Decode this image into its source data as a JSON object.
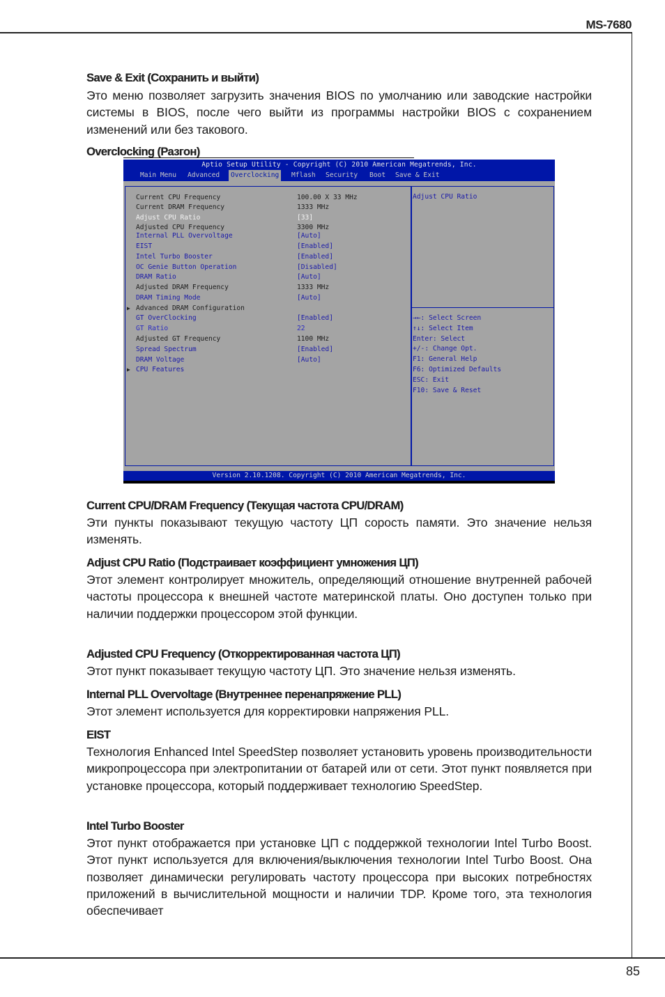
{
  "header": {
    "model": "MS-7680"
  },
  "footer": {
    "page_number": "85"
  },
  "sections_top": [
    {
      "heading": "Save & Exit (Сохранить и выйти)",
      "text": "Это меню позволяет загрузить значения BIOS по умолчанию или заводские настройки системы в BIOS, после чего выйти из программы настройки BIOS с сохранением изменений или без такового."
    },
    {
      "heading": "Overclocking (Разгон)"
    }
  ],
  "bios": {
    "title": "Aptio Setup Utility - Copyright (C) 2010 American Megatrends, Inc.",
    "tabs": [
      "Main Menu",
      "Advanced",
      "Overclocking",
      "Mflash",
      "Security",
      "Boot",
      "Save & Exit"
    ],
    "active_tab": "Overclocking",
    "rows": [
      {
        "label": "Current CPU Frequency",
        "value": "100.00 X 33 MHz",
        "style": "dark",
        "submenu": false
      },
      {
        "label": "Current DRAM Frequency",
        "value": "1333 MHz",
        "style": "dark",
        "submenu": false
      },
      {
        "label": "Adjust CPU Ratio",
        "value": "[33]",
        "style": "selected",
        "submenu": false
      },
      {
        "label": "Adjusted CPU Frequency",
        "value": "3300 MHz",
        "style": "dark",
        "submenu": false
      },
      {
        "label": "Internal PLL Overvoltage",
        "value": "[Auto]",
        "style": "blue",
        "submenu": false
      },
      {
        "label": "EIST",
        "value": "[Enabled]",
        "style": "blue",
        "submenu": false
      },
      {
        "label": "Intel Turbo Booster",
        "value": "[Enabled]",
        "style": "blue",
        "submenu": false
      },
      {
        "label": "OC Genie Button Operation",
        "value": "[Disabled]",
        "style": "blue",
        "submenu": false
      },
      {
        "label": "DRAM Ratio",
        "value": "[Auto]",
        "style": "blue",
        "submenu": false
      },
      {
        "label": "Adjusted DRAM Frequency",
        "value": "1333 MHz",
        "style": "dark",
        "submenu": false
      },
      {
        "label": "DRAM Timing Mode",
        "value": "[Auto]",
        "style": "blue",
        "submenu": false
      },
      {
        "label": "Advanced DRAM Configuration",
        "value": "",
        "style": "dark",
        "submenu": true
      },
      {
        "label": "GT OverClocking",
        "value": "[Enabled]",
        "style": "blue",
        "submenu": false
      },
      {
        "label": "GT Ratio",
        "value": "22",
        "style": "lblue",
        "submenu": false
      },
      {
        "label": "Adjusted GT Frequency",
        "value": "1100 MHz",
        "style": "dark",
        "submenu": false
      },
      {
        "label": "Spread Spectrum",
        "value": "[Enabled]",
        "style": "blue",
        "submenu": false
      },
      {
        "label": "DRAM Voltage",
        "value": "[Auto]",
        "style": "blue",
        "submenu": false
      },
      {
        "label": "CPU Features",
        "value": "",
        "style": "blue",
        "submenu": true
      }
    ],
    "help_title": "Adjust CPU Ratio",
    "key_help": [
      "→←: Select Screen",
      "↑↓: Select Item",
      "Enter: Select",
      "+/-: Change Opt.",
      "F1: General Help",
      "F6: Optimized Defaults",
      "ESC: Exit",
      "F10: Save & Reset"
    ],
    "footer": "Version 2.10.1208. Copyright (C) 2010 American Megatrends, Inc.",
    "colors": {
      "bar": "#0016a8",
      "panel": "#a4a4a4",
      "text_blue": "#1a1aa8",
      "text_dark": "#1c1c1c",
      "selected": "#f4f4f4"
    }
  },
  "sections": [
    {
      "heading": "Current CPU/DRAM Frequency (Текущая частота CPU/DRAM)",
      "text": "Эти пункты показывают текущую частоту ЦП сорость памяти. Это значение нельзя изменять."
    },
    {
      "heading": "Adjust CPU Ratio (Подстраивает коэффициент умножения ЦП)",
      "text": "Этот элемент контролирует множитель, определяющий отношение внутренней рабочей частоты процессора к внешней частоте материнской платы. Оно доступен только при наличии поддержки процессором этой функции."
    },
    {
      "heading": "Adjusted CPU Frequency (Откорректированная частота ЦП)",
      "text": "Этот пункт показывает текущую частоту ЦП. Это значение нельзя изменять."
    },
    {
      "heading": "Internal PLL Overvoltage (Внутреннее перенапряжение PLL)",
      "text": "Этот элемент используется для корректировки напряжения PLL."
    },
    {
      "heading": "EIST",
      "text": "Технология Enhanced Intel SpeedStep позволяет установить уровень производительности микропроцессора при электропитании от батарей или от сети. Этот пункт появляется при установке процессора, который поддерживает технологию SpeedStep."
    },
    {
      "heading": "Intel Turbo Booster",
      "text": "Этот пункт отображается при установке ЦП с поддержкой технологии Intel Turbo Boost. Этот пункт используется для включения/выключения технологии Intel Turbo Boost. Она позволяет динамически регулировать частоту процессора при высоких потребностях приложений в вычислительной мощности и наличии TDP. Кроме того, эта технология обеспечивает"
    }
  ]
}
